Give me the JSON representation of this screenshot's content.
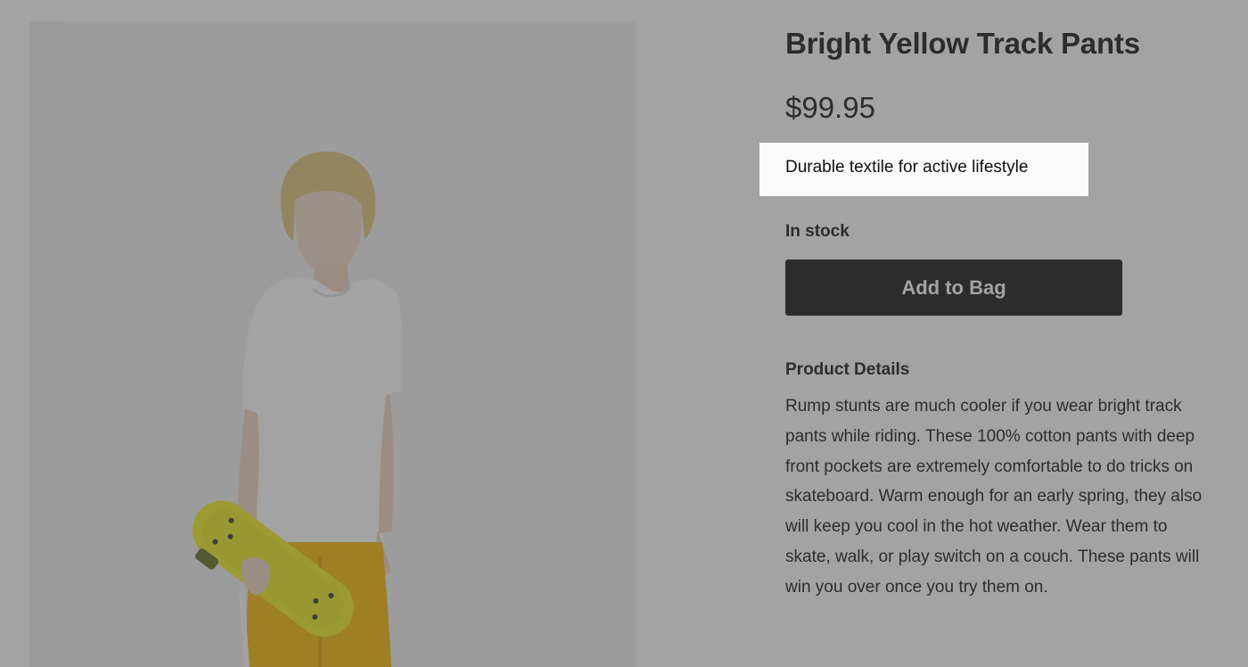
{
  "product": {
    "title": "Bright Yellow Track Pants",
    "price": "$99.95",
    "tagline": "Durable textile for active lifestyle",
    "stock_status": "In stock",
    "add_to_bag_label": "Add to Bag",
    "details_heading": "Product Details",
    "details_text": "Rump stunts are much cooler if you wear bright track pants while riding. These 100% cotton pants with deep front pockets are extremely comfortable to do tricks on skateboard. Warm enough for an early spring, they also will keep you cool in the hot weather. Wear them to skate, walk, or play switch on a couch. These pants will win you over once you try them on."
  },
  "colors": {
    "overlay": "#484848",
    "highlight_box": "#fafafa",
    "button_bg": "#111111",
    "pants": "#f2b705",
    "skateboard": "#f0ec1f"
  }
}
